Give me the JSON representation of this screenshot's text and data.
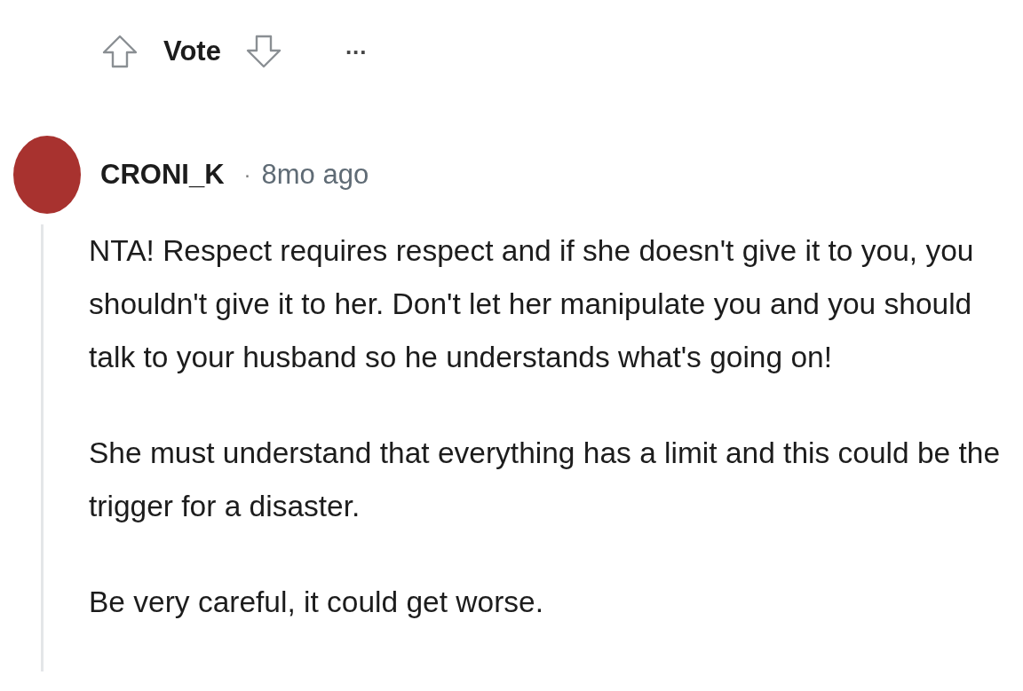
{
  "vote_bar": {
    "label": "Vote",
    "more": "..."
  },
  "comment": {
    "author": "CRONI_K",
    "separator": "·",
    "time": "8mo ago",
    "paragraphs": [
      "NTA! Respect requires respect and if she doesn't give it to you, you shouldn't give it to her. Don't let her manipulate you and you should talk to your husband so he understands what's going on!",
      "She must understand that everything has a limit and this could be the trigger for a disaster.",
      "Be very careful, it could get worse."
    ]
  }
}
